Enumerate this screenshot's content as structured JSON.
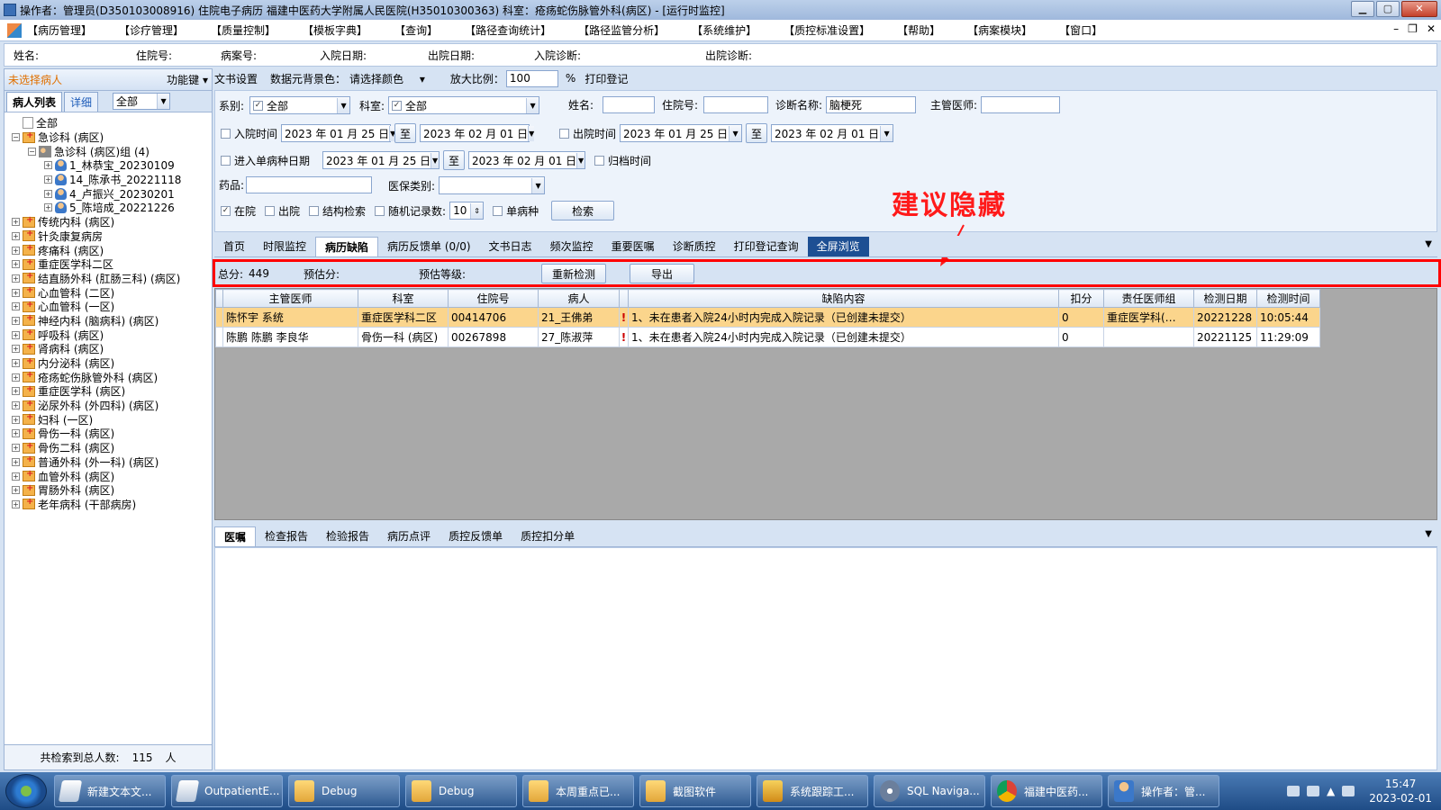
{
  "window": {
    "title": "操作者：管理员(D350103008916) 住院电子病历  福建中医药大学附属人民医院(H35010300363)  科室：疮疡蛇伤脉管外科(病区) - [运行时监控]"
  },
  "menu": [
    "【病历管理】",
    "【诊疗管理】",
    "【质量控制】",
    "【模板字典】",
    "【查询】",
    "【路径查询统计】",
    "【路径监管分析】",
    "【系统维护】",
    "【质控标准设置】",
    "【帮助】",
    "【病案模块】",
    "【窗口】"
  ],
  "patient_info": {
    "name": "姓名:",
    "inpatient_no": "住院号:",
    "record_no": "病案号:",
    "admit_date": "入院日期:",
    "discharge_date": "出院日期:",
    "admit_diag": "入院诊断:",
    "discharge_diag": "出院诊断:"
  },
  "left": {
    "no_patient": "未选择病人",
    "func_key": "功能键",
    "tab_list": "病人列表",
    "tab_detail": "详细",
    "filter_value": "全部",
    "tree": [
      {
        "label": "全部",
        "level": 0,
        "icon": "page-icon"
      },
      {
        "label": "急诊科 (病区)",
        "level": 0,
        "icon": "folder-icon",
        "exp": "−"
      },
      {
        "label": "急诊科 (病区)组 (4)",
        "level": 1,
        "icon": "group-icon",
        "exp": "−"
      },
      {
        "label": "1_林恭宝_20230109",
        "level": 2,
        "icon": "person-icon",
        "exp": "+"
      },
      {
        "label": "14_陈承书_20221118",
        "level": 2,
        "icon": "person-icon",
        "exp": "+"
      },
      {
        "label": "4_卢振兴_20230201",
        "level": 2,
        "icon": "person-icon",
        "exp": "+"
      },
      {
        "label": "5_陈培成_20221226",
        "level": 2,
        "icon": "person-icon",
        "exp": "+"
      },
      {
        "label": "传统内科 (病区)",
        "level": 0,
        "icon": "folder-icon",
        "exp": "+"
      },
      {
        "label": "针灸康复病房",
        "level": 0,
        "icon": "folder-icon",
        "exp": "+"
      },
      {
        "label": "疼痛科 (病区)",
        "level": 0,
        "icon": "folder-icon",
        "exp": "+"
      },
      {
        "label": "重症医学科二区",
        "level": 0,
        "icon": "folder-icon",
        "exp": "+"
      },
      {
        "label": "结直肠外科 (肛肠三科) (病区)",
        "level": 0,
        "icon": "folder-icon",
        "exp": "+"
      },
      {
        "label": "心血管科 (二区)",
        "level": 0,
        "icon": "folder-icon",
        "exp": "+"
      },
      {
        "label": "心血管科 (一区)",
        "level": 0,
        "icon": "folder-icon",
        "exp": "+"
      },
      {
        "label": "神经内科 (脑病科) (病区)",
        "level": 0,
        "icon": "folder-icon",
        "exp": "+"
      },
      {
        "label": "呼吸科 (病区)",
        "level": 0,
        "icon": "folder-icon",
        "exp": "+"
      },
      {
        "label": "肾病科 (病区)",
        "level": 0,
        "icon": "folder-icon",
        "exp": "+"
      },
      {
        "label": "内分泌科 (病区)",
        "level": 0,
        "icon": "folder-icon",
        "exp": "+"
      },
      {
        "label": "疮疡蛇伤脉管外科 (病区)",
        "level": 0,
        "icon": "folder-icon",
        "exp": "+"
      },
      {
        "label": "重症医学科 (病区)",
        "level": 0,
        "icon": "folder-icon",
        "exp": "+"
      },
      {
        "label": "泌尿外科 (外四科) (病区)",
        "level": 0,
        "icon": "folder-icon",
        "exp": "+"
      },
      {
        "label": "妇科 (一区)",
        "level": 0,
        "icon": "folder-icon",
        "exp": "+"
      },
      {
        "label": "骨伤一科 (病区)",
        "level": 0,
        "icon": "folder-icon",
        "exp": "+"
      },
      {
        "label": "骨伤二科 (病区)",
        "level": 0,
        "icon": "folder-icon",
        "exp": "+"
      },
      {
        "label": "普通外科 (外一科) (病区)",
        "level": 0,
        "icon": "folder-icon",
        "exp": "+"
      },
      {
        "label": "血管外科 (病区)",
        "level": 0,
        "icon": "folder-icon",
        "exp": "+"
      },
      {
        "label": "胃肠外科 (病区)",
        "level": 0,
        "icon": "folder-icon",
        "exp": "+"
      },
      {
        "label": "老年病科 (干部病房)",
        "level": 0,
        "icon": "folder-icon",
        "exp": "+"
      }
    ],
    "footer_label": "共检索到总人数:",
    "footer_count": "115",
    "footer_unit": "人"
  },
  "toolbar2": {
    "doc_settings": "文书设置",
    "bg_color_label": "数据元背景色：",
    "bg_color_value": "请选择颜色",
    "zoom_label": "放大比例：",
    "zoom_value": "100",
    "zoom_unit": "%",
    "print_reg": "打印登记"
  },
  "filters": {
    "dept_series_label": "系别:",
    "dept_series_value": "全部",
    "dept_label": "科室:",
    "dept_value": "全部",
    "name_label": "姓名:",
    "inpatient_label": "住院号:",
    "diag_label": "诊断名称:",
    "diag_value": "脑梗死",
    "doctor_label": "主管医师:",
    "admit_time_label": "入院时间",
    "admit_from": "2023 年 01 月 25 日",
    "to1": "至",
    "admit_to": "2023 年 02 月 01 日",
    "discharge_time_label": "出院时间",
    "discharge_from": "2023 年 01 月 25 日",
    "to2": "至",
    "discharge_to": "2023 年 02 月 01 日",
    "single_disease_label": "进入单病种日期",
    "single_from": "2023 年 01 月 25 日",
    "to3": "至",
    "single_to": "2023 年 02 月 01 日",
    "archive_label": "归档时间",
    "drug_label": "药品:",
    "insurance_label": "医保类别:",
    "in_hospital": "在院",
    "discharged": "出院",
    "struct_search": "结构检索",
    "random_label": "随机记录数:",
    "random_value": "10",
    "single_disease": "单病种",
    "search_btn": "检索"
  },
  "tabs1": [
    "首页",
    "时限监控",
    "病历缺陷",
    "病历反馈单 (0/0)",
    "文书日志",
    "频次监控",
    "重要医嘱",
    "诊断质控",
    "打印登记查询",
    "全屏浏览"
  ],
  "annotation": "建议隐藏",
  "summary": {
    "total_label": "总分:",
    "total_value": "449",
    "est_label": "预估分:",
    "grade_label": "预估等级:",
    "recheck_btn": "重新检测",
    "export_btn": "导出"
  },
  "grid": {
    "columns": [
      "主管医师",
      "科室",
      "住院号",
      "病人",
      "",
      "缺陷内容",
      "扣分",
      "责任医师组",
      "检测日期",
      "检测时间"
    ],
    "rows": [
      [
        "陈怀宇  系统",
        "重症医学科二区",
        "00414706",
        "21_王佛弟",
        "!",
        "1、未在患者入院24小时内完成入院记录（已创建未提交）",
        "0",
        "重症医学科(…",
        "20221228",
        "10:05:44"
      ],
      [
        "陈鹏 陈鹏  李良华",
        "骨伤一科 (病区)",
        "00267898",
        "27_陈淑萍",
        "!",
        "1、未在患者入院24小时内完成入院记录（已创建未提交）",
        "0",
        "",
        "20221125",
        "11:29:09"
      ]
    ]
  },
  "tabs2": [
    "医嘱",
    "检查报告",
    "检验报告",
    "病历点评",
    "质控反馈单",
    "质控扣分单"
  ],
  "taskbar": {
    "items": [
      {
        "label": "新建文本文...",
        "icon": "txt"
      },
      {
        "label": "OutpatientE...",
        "icon": "txt"
      },
      {
        "label": "Debug",
        "icon": "fold"
      },
      {
        "label": "Debug",
        "icon": "fold"
      },
      {
        "label": "本周重点已...",
        "icon": "fold"
      },
      {
        "label": "截图软件",
        "icon": "fold"
      },
      {
        "label": "系统跟踪工...",
        "icon": "sql"
      },
      {
        "label": "SQL Naviga...",
        "icon": "nav"
      },
      {
        "label": "福建中医药...",
        "icon": "chrome"
      },
      {
        "label": "操作者：管...",
        "icon": "doc"
      }
    ],
    "time": "15:47",
    "date": "2023-02-01"
  }
}
